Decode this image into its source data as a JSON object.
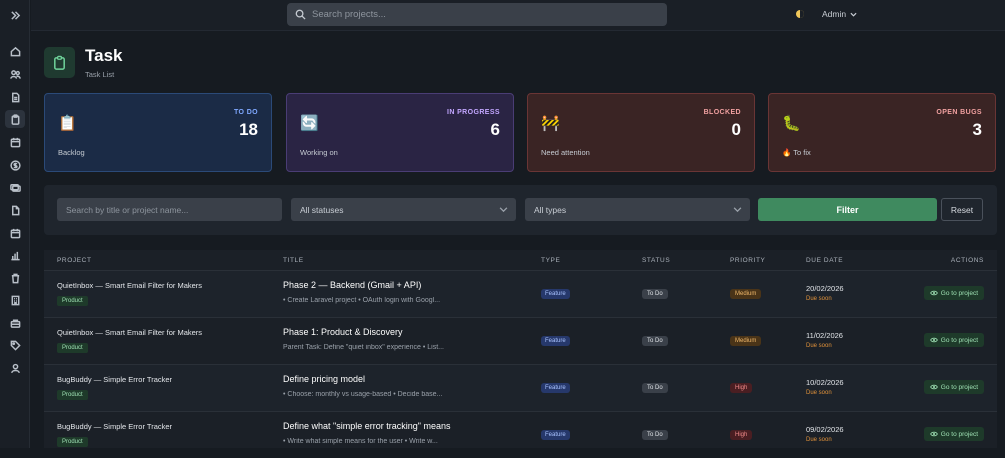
{
  "topbar": {
    "search_placeholder": "Search projects...",
    "user": "Admin"
  },
  "page": {
    "title": "Task",
    "subtitle": "Task List"
  },
  "stats": [
    {
      "label": "TO DO",
      "value": "18",
      "caption": "Backlog",
      "emoji": "📋",
      "color": "#7fa8ff"
    },
    {
      "label": "IN PROGRESS",
      "value": "6",
      "caption": "Working on",
      "emoji": "🔄",
      "color": "#c2a6ff"
    },
    {
      "label": "BLOCKED",
      "value": "0",
      "caption": "Need attention",
      "emoji": "🚧",
      "color": "#f0a0a0"
    },
    {
      "label": "OPEN BUGS",
      "value": "3",
      "caption": "🔥 To fix",
      "emoji": "🐛",
      "color": "#f0a0a0"
    }
  ],
  "filters": {
    "search_placeholder": "Search by title or project name...",
    "status": "All statuses",
    "type": "All types",
    "filter_label": "Filter",
    "reset_label": "Reset"
  },
  "table": {
    "headers": [
      "PROJECT",
      "TITLE",
      "TYPE",
      "STATUS",
      "PRIORITY",
      "DUE DATE",
      "ACTIONS"
    ],
    "rows": [
      {
        "project": "QuietInbox — Smart Email Filter for Makers",
        "tag": "Product",
        "title": "Phase 2 — Backend (Gmail + API)",
        "sub": "• Create Laravel project • OAuth login with Googl...",
        "type": "Feature",
        "status": "To Do",
        "priority": "Medium",
        "priority_level": "med",
        "due": "20/02/2026",
        "due_note": "Due soon",
        "action": "Go to project"
      },
      {
        "project": "QuietInbox — Smart Email Filter for Makers",
        "tag": "Product",
        "title": "Phase 1: Product & Discovery",
        "sub": "Parent Task: Define \"quiet inbox\" experience • List...",
        "type": "Feature",
        "status": "To Do",
        "priority": "Medium",
        "priority_level": "med",
        "due": "11/02/2026",
        "due_note": "Due soon",
        "action": "Go to project"
      },
      {
        "project": "BugBuddy — Simple Error Tracker",
        "tag": "Product",
        "title": "Define pricing model",
        "sub": "• Choose: monthly vs usage-based • Decide base...",
        "type": "Feature",
        "status": "To Do",
        "priority": "High",
        "priority_level": "high",
        "due": "10/02/2026",
        "due_note": "Due soon",
        "action": "Go to project"
      },
      {
        "project": "BugBuddy — Simple Error Tracker",
        "tag": "Product",
        "title": "Define what \"simple error tracking\" means",
        "sub": "• Write what simple means for the user • Write w...",
        "type": "Feature",
        "status": "To Do",
        "priority": "High",
        "priority_level": "high",
        "due": "09/02/2026",
        "due_note": "Due soon",
        "action": "Go to project"
      }
    ]
  },
  "sidebar": {
    "icons": [
      "expand-icon",
      "home-icon",
      "users-icon",
      "document-icon",
      "clipboard-icon",
      "calendar-icon",
      "dollar-icon",
      "money-icon",
      "file-icon",
      "calendar2-icon",
      "chart-icon",
      "trash-icon",
      "building-icon",
      "briefcase-icon",
      "tag-icon",
      "user-icon"
    ]
  }
}
